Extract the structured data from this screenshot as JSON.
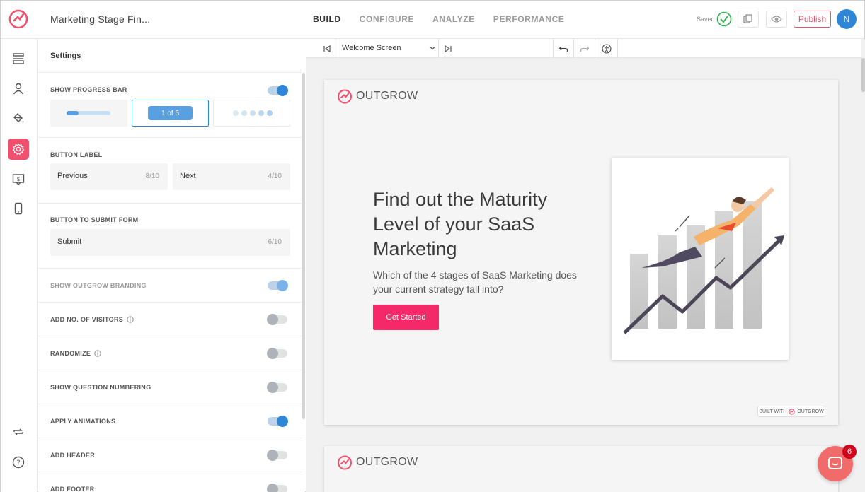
{
  "app": {
    "project_title": "Marketing Stage Fin...",
    "nav": [
      "BUILD",
      "CONFIGURE",
      "ANALYZE",
      "PERFORMANCE"
    ],
    "active_nav": "BUILD",
    "saved_label": "Saved",
    "publish_label": "Publish",
    "avatar_initial": "N",
    "brand_color": "#f0506e",
    "accent_color": "#2f86d6"
  },
  "rail": {
    "icons": [
      "layout-icon",
      "user-icon",
      "paint-bucket-icon",
      "gear-icon",
      "pricing-icon",
      "mobile-icon",
      "refresh-icon",
      "help-icon"
    ],
    "active": "gear-icon"
  },
  "settings": {
    "title": "Settings",
    "progress_bar": {
      "label": "SHOW PROGRESS BAR",
      "enabled": true,
      "options": [
        "bar",
        "1 of 5",
        "dots"
      ],
      "selected": "1 of 5",
      "pill_label": "1 of 5"
    },
    "button_label": {
      "label": "BUTTON LABEL",
      "previous": {
        "text": "Previous",
        "count": "8/10"
      },
      "next": {
        "text": "Next",
        "count": "4/10"
      }
    },
    "submit": {
      "label": "BUTTON TO SUBMIT FORM",
      "text": "Submit",
      "count": "6/10"
    },
    "toggles": [
      {
        "label": "SHOW OUTGROW BRANDING",
        "on": true,
        "dim": true
      },
      {
        "label": "ADD NO. OF VISITORS",
        "on": false,
        "info": true
      },
      {
        "label": "RANDOMIZE",
        "on": false,
        "info": true
      },
      {
        "label": "SHOW QUESTION NUMBERING",
        "on": false
      },
      {
        "label": "APPLY ANIMATIONS",
        "on": true
      },
      {
        "label": "ADD HEADER",
        "on": false
      },
      {
        "label": "ADD FOOTER",
        "on": false
      }
    ]
  },
  "canvas": {
    "screen_select": "Welcome Screen",
    "card": {
      "logo_text": "OUTGROW",
      "headline": "Find out the Maturity Level of your SaaS Marketing",
      "subhead": "Which of the 4 stages of SaaS Marketing does your current strategy fall into?",
      "cta": "Get Started",
      "built_with": "BUILT WITH",
      "built_brand": "OUTGROW"
    },
    "card2_logo_text": "OUTGROW"
  },
  "chat": {
    "badge": "6"
  }
}
